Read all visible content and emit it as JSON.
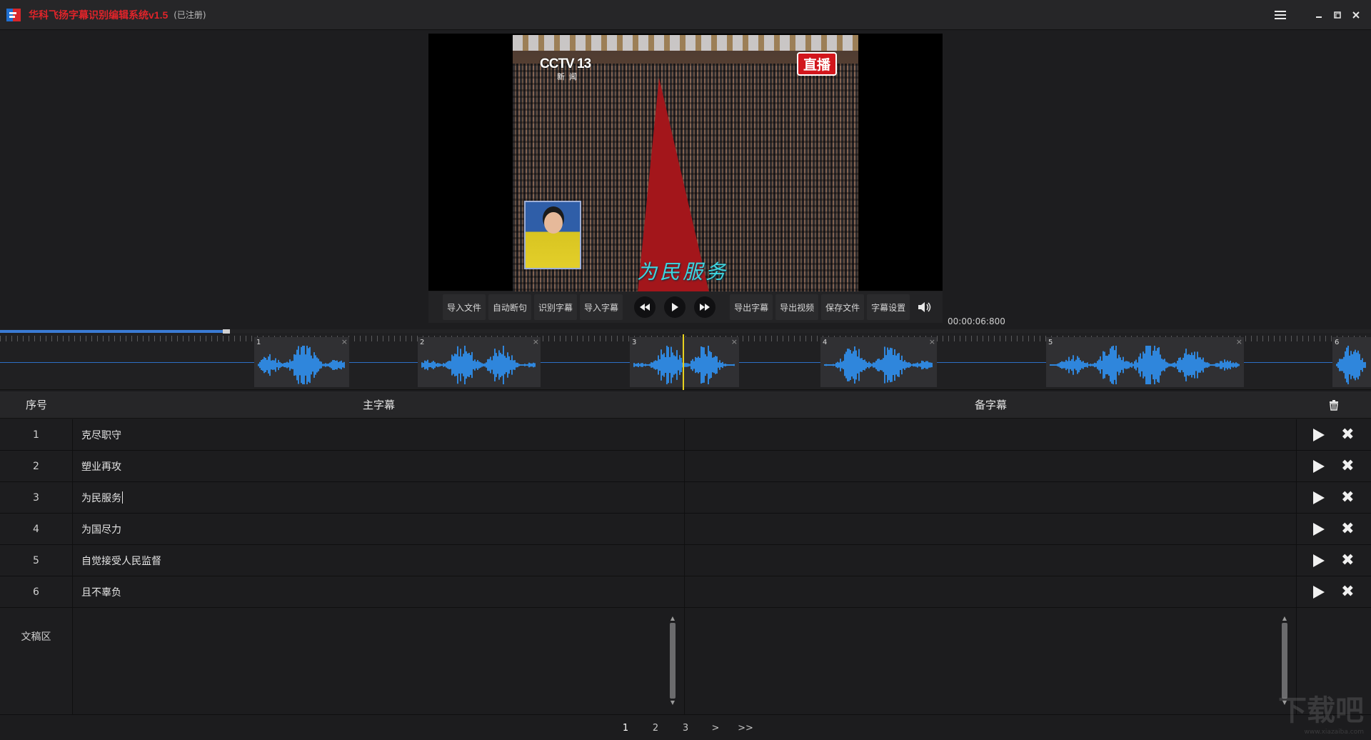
{
  "window": {
    "title": "华科飞扬字幕识别编辑系统v1.5",
    "status": "(已注册)",
    "colors": {
      "title": "#e0242a",
      "accent": "#3a7bd5",
      "playhead": "#e8d21f"
    }
  },
  "video": {
    "channel_logo": "CCTV 13",
    "channel_sub": "新闻",
    "live_badge": "直播",
    "burned_subtitle": "为民服务"
  },
  "toolbar": {
    "import_file": "导入文件",
    "auto_split": "自动断句",
    "recognize": "识别字幕",
    "import_sub": "导入字幕",
    "export_sub": "导出字幕",
    "export_video": "导出视频",
    "save_file": "保存文件",
    "sub_settings": "字幕设置",
    "icons": [
      "prev-icon",
      "play-icon",
      "next-icon",
      "volume-icon"
    ]
  },
  "timecode": "00:00:06:800",
  "progress": {
    "fraction": 0.165
  },
  "timeline": {
    "segments": [
      {
        "num": "1"
      },
      {
        "num": "2"
      },
      {
        "num": "3"
      },
      {
        "num": "4"
      },
      {
        "num": "5"
      },
      {
        "num": "6"
      }
    ]
  },
  "table": {
    "headers": {
      "no": "序号",
      "main": "主字幕",
      "backup": "备字幕"
    },
    "rows": [
      {
        "no": "1",
        "main": "克尽职守",
        "backup": ""
      },
      {
        "no": "2",
        "main": "塑业再攻",
        "backup": ""
      },
      {
        "no": "3",
        "main": "为民服务",
        "backup": ""
      },
      {
        "no": "4",
        "main": "为国尽力",
        "backup": ""
      },
      {
        "no": "5",
        "main": "自觉接受人民监督",
        "backup": ""
      },
      {
        "no": "6",
        "main": "且不辜负",
        "backup": ""
      }
    ],
    "draft_label": "文稿区"
  },
  "pager": {
    "pages": [
      "1",
      "2",
      "3",
      ">",
      ">>"
    ],
    "current": "1"
  },
  "watermark": {
    "main": "下载吧",
    "sub": "www.xiazaiba.com"
  }
}
